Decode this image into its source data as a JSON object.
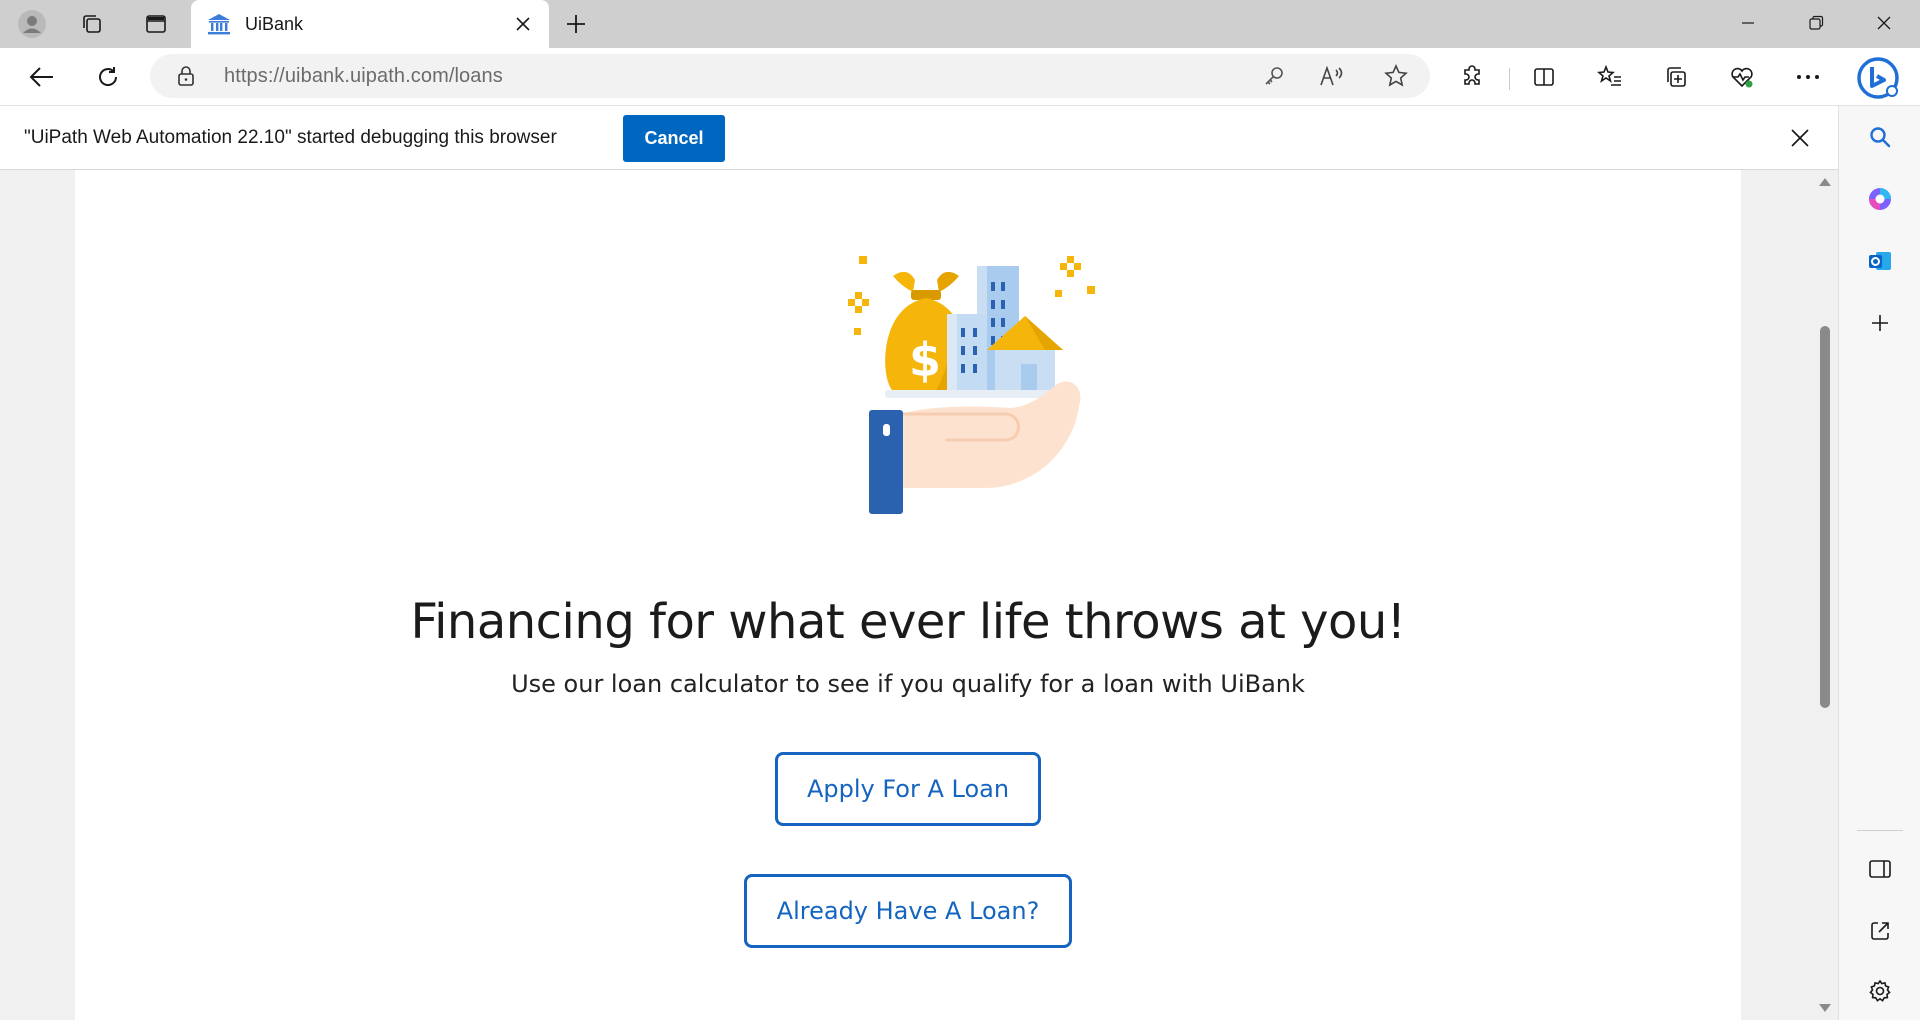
{
  "browser": {
    "tab": {
      "title": "UiBank"
    },
    "address_bar": {
      "url_host": "https://uibank.uipath.com",
      "url_path": "/loans"
    },
    "infobar": {
      "message": "\"UiPath Web Automation 22.10\" started debugging this browser",
      "cancel_label": "Cancel"
    }
  },
  "page": {
    "headline": "Financing for what ever life throws at you!",
    "subheadline": "Use our loan calculator to see if you qualify for a loan with UiBank",
    "buttons": {
      "apply_label": "Apply For A Loan",
      "existing_label": "Already Have A Loan?"
    }
  },
  "icons": {
    "tabstrip": [
      "profile-icon",
      "workspaces-icon",
      "vertical-tabs-icon",
      "bank-favicon-icon",
      "close-tab-icon",
      "new-tab-icon"
    ],
    "window": [
      "minimize-icon",
      "restore-icon",
      "close-window-icon"
    ],
    "toolbar": [
      "back-icon",
      "refresh-icon",
      "lock-icon",
      "key-icon",
      "read-aloud-icon",
      "favorite-star-icon",
      "extensions-icon",
      "split-screen-icon",
      "favorites-icon",
      "collections-icon",
      "browser-essentials-icon",
      "more-icon",
      "bing-copilot-icon"
    ],
    "sidebar": [
      "search-icon",
      "copilot-icon",
      "outlook-icon",
      "add-icon",
      "sidebar-toggle-icon",
      "open-external-icon",
      "settings-icon"
    ]
  },
  "colors": {
    "accent_blue": "#1565c0",
    "cancel_blue": "#0067c0",
    "coin_gold": "#f5b50b",
    "building_blue": "#a9ccee",
    "sleeve_blue": "#2a62b0",
    "hand_skin": "#fde3cf"
  }
}
